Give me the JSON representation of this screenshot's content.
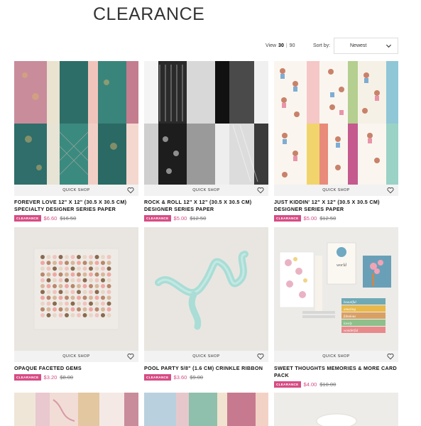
{
  "page": {
    "title": "CLEARANCE"
  },
  "toolbar": {
    "view_label": "View",
    "view_options": [
      "30",
      "90"
    ],
    "sort_label": "Sort by:",
    "sort_value": "Newest"
  },
  "products": [
    {
      "name": "FOREVER LOVE 12\" X 12\" (30.5 X 30.5 CM) SPECIALTY DESIGNER SERIES PAPER",
      "badge": "CLEARANCE",
      "price": "$6.60",
      "original_price": "$16.50",
      "quick_shop": "QUICK SHOP"
    },
    {
      "name": "ROCK & ROLL 12\" X 12\" (30.5 X 30.5 CM) DESIGNER SERIES PAPER",
      "badge": "CLEARANCE",
      "price": "$5.00",
      "original_price": "$12.50",
      "quick_shop": "QUICK SHOP"
    },
    {
      "name": "JUST KIDDIN' 12\" X 12\" (30.5 X 30.5 CM) DESIGNER SERIES PAPER",
      "badge": "CLEARANCE",
      "price": "$5.00",
      "original_price": "$12.50",
      "quick_shop": "QUICK SHOP"
    },
    {
      "name": "OPAQUE FACETED GEMS",
      "badge": "CLEARANCE",
      "price": "$3.20",
      "original_price": "$8.00",
      "quick_shop": "QUICK SHOP"
    },
    {
      "name": "POOL PARTY 5/8\" (1.6 CM) CRINKLE RIBBON",
      "badge": "CLEARANCE",
      "price": "$3.60",
      "original_price": "$9.00",
      "quick_shop": "QUICK SHOP"
    },
    {
      "name": "SWEET THOUGHTS MEMORIES & MORE CARD PACK",
      "badge": "CLEARANCE",
      "price": "$4.00",
      "original_price": "$10.00",
      "quick_shop": "QUICK SHOP"
    }
  ],
  "card_pack_words": [
    "world",
    "beautiful",
    "amazing",
    "fabulous",
    "lovely",
    "wonderful"
  ],
  "colors": {
    "accent": "#d64c84",
    "quickshop_bg": "#f2f2f2"
  }
}
